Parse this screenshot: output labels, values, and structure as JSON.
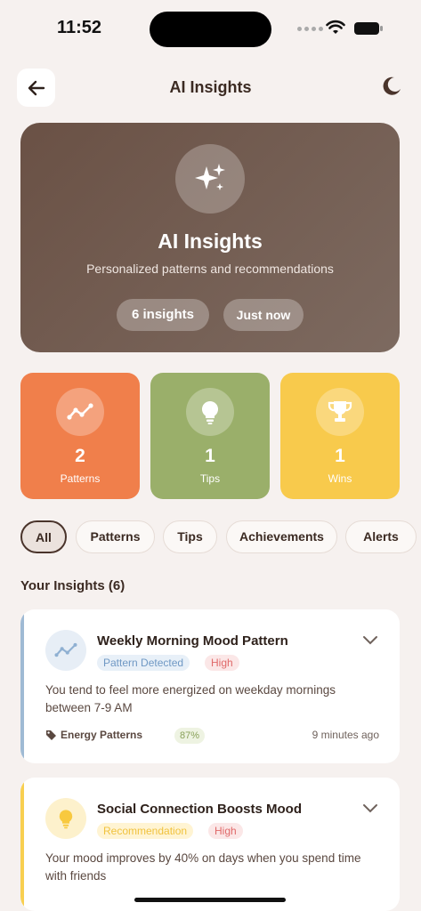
{
  "status_bar": {
    "time": "11:52"
  },
  "header": {
    "title": "AI Insights",
    "back_icon": "arrow-left-icon",
    "theme_icon": "moon-icon"
  },
  "hero": {
    "icon": "sparkles-icon",
    "title": "AI Insights",
    "subtitle": "Personalized patterns and recommendations",
    "count_label": "6 insights",
    "updated_label": "Just now"
  },
  "stats": [
    {
      "value": "2",
      "label": "Patterns",
      "icon": "trend-line-icon",
      "color": "#f07f4b"
    },
    {
      "value": "1",
      "label": "Tips",
      "icon": "lightbulb-icon",
      "color": "#9aaf6a"
    },
    {
      "value": "1",
      "label": "Wins",
      "icon": "trophy-icon",
      "color": "#f8ca4c"
    }
  ],
  "filters": {
    "selected": "All",
    "items": [
      "All",
      "Patterns",
      "Tips",
      "Achievements",
      "Alerts"
    ]
  },
  "section_title": "Your Insights (6)",
  "insights": [
    {
      "title": "Weekly Morning Mood Pattern",
      "type": "Pattern Detected",
      "priority": "High",
      "description": "You tend to feel more energized on weekday mornings between 7-9 AM",
      "category": "Energy Patterns",
      "confidence": "87%",
      "time": "9 minutes ago",
      "icon": "trend-line-icon",
      "accent": "#9fbad4"
    },
    {
      "title": "Social Connection Boosts Mood",
      "type": "Recommendation",
      "priority": "High",
      "description": "Your mood improves by 40% on days when you spend time with friends",
      "icon": "lightbulb-icon",
      "accent": "#f8cf50"
    }
  ]
}
